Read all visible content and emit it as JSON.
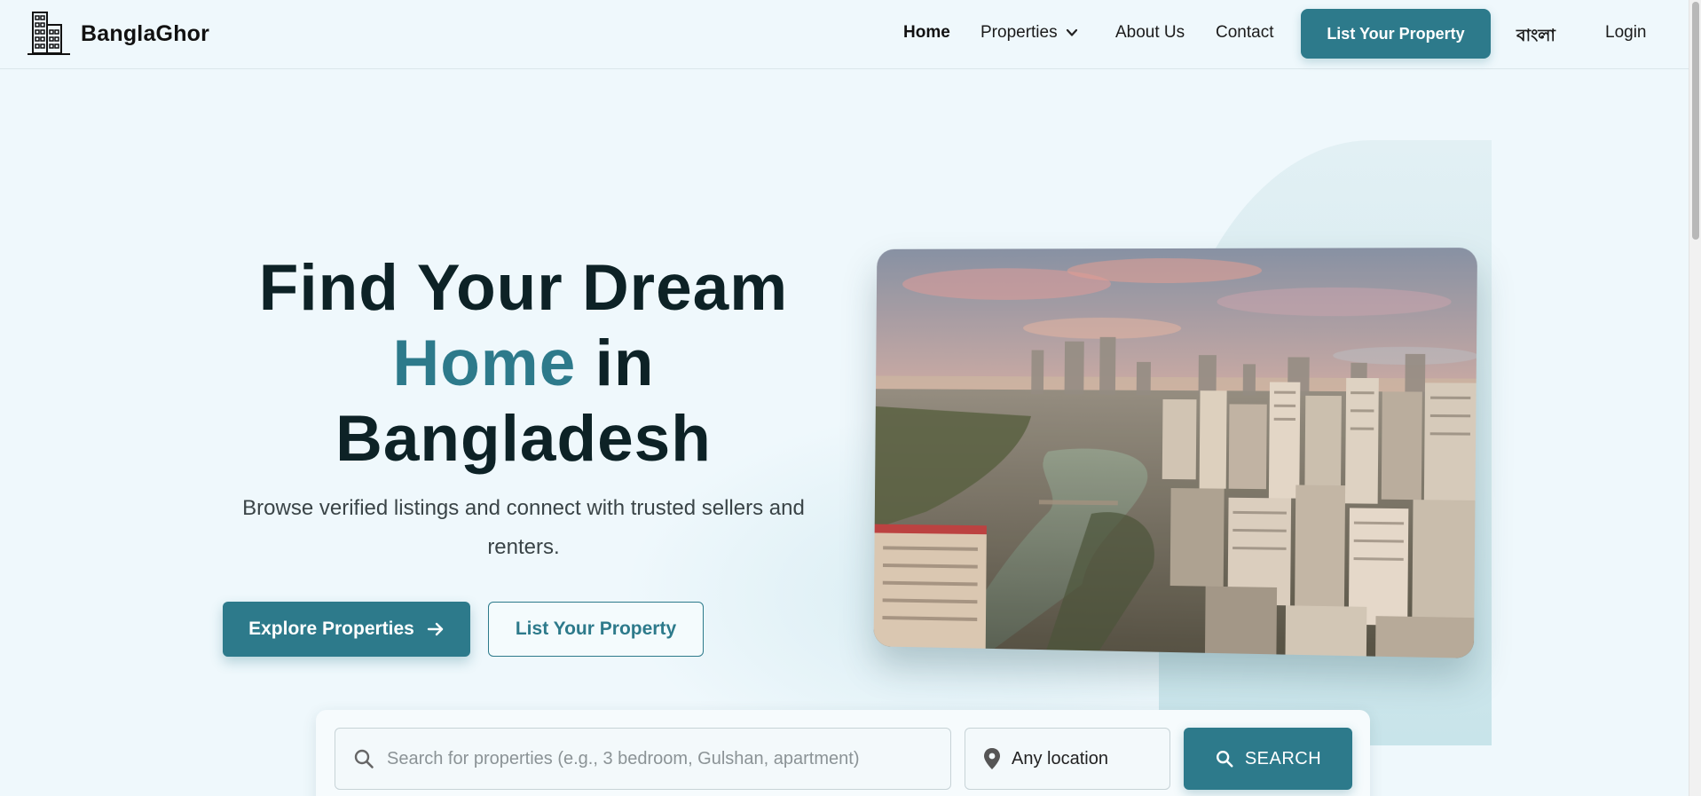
{
  "brand": {
    "name": "BanglaGhor",
    "logo_icon": "building-icon"
  },
  "nav": {
    "home": "Home",
    "properties": "Properties",
    "about": "About Us",
    "contact": "Contact",
    "list_property": "List Your Property",
    "language": "বাংলা",
    "login": "Login"
  },
  "hero": {
    "title_line1": "Find Your Dream",
    "title_accent": "Home",
    "title_in": "in",
    "title_line3": "Bangladesh",
    "subtitle": "Browse verified listings and connect with trusted sellers and renters.",
    "explore_label": "Explore Properties",
    "list_label": "List Your Property"
  },
  "search": {
    "placeholder": "Search for properties (e.g., 3 bedroom, Gulshan, apartment)",
    "value": "",
    "location": "Any location",
    "button": "SEARCH"
  },
  "colors": {
    "accent": "#2d7a8b",
    "background": "#eff8fc",
    "heading": "#0d2226"
  }
}
